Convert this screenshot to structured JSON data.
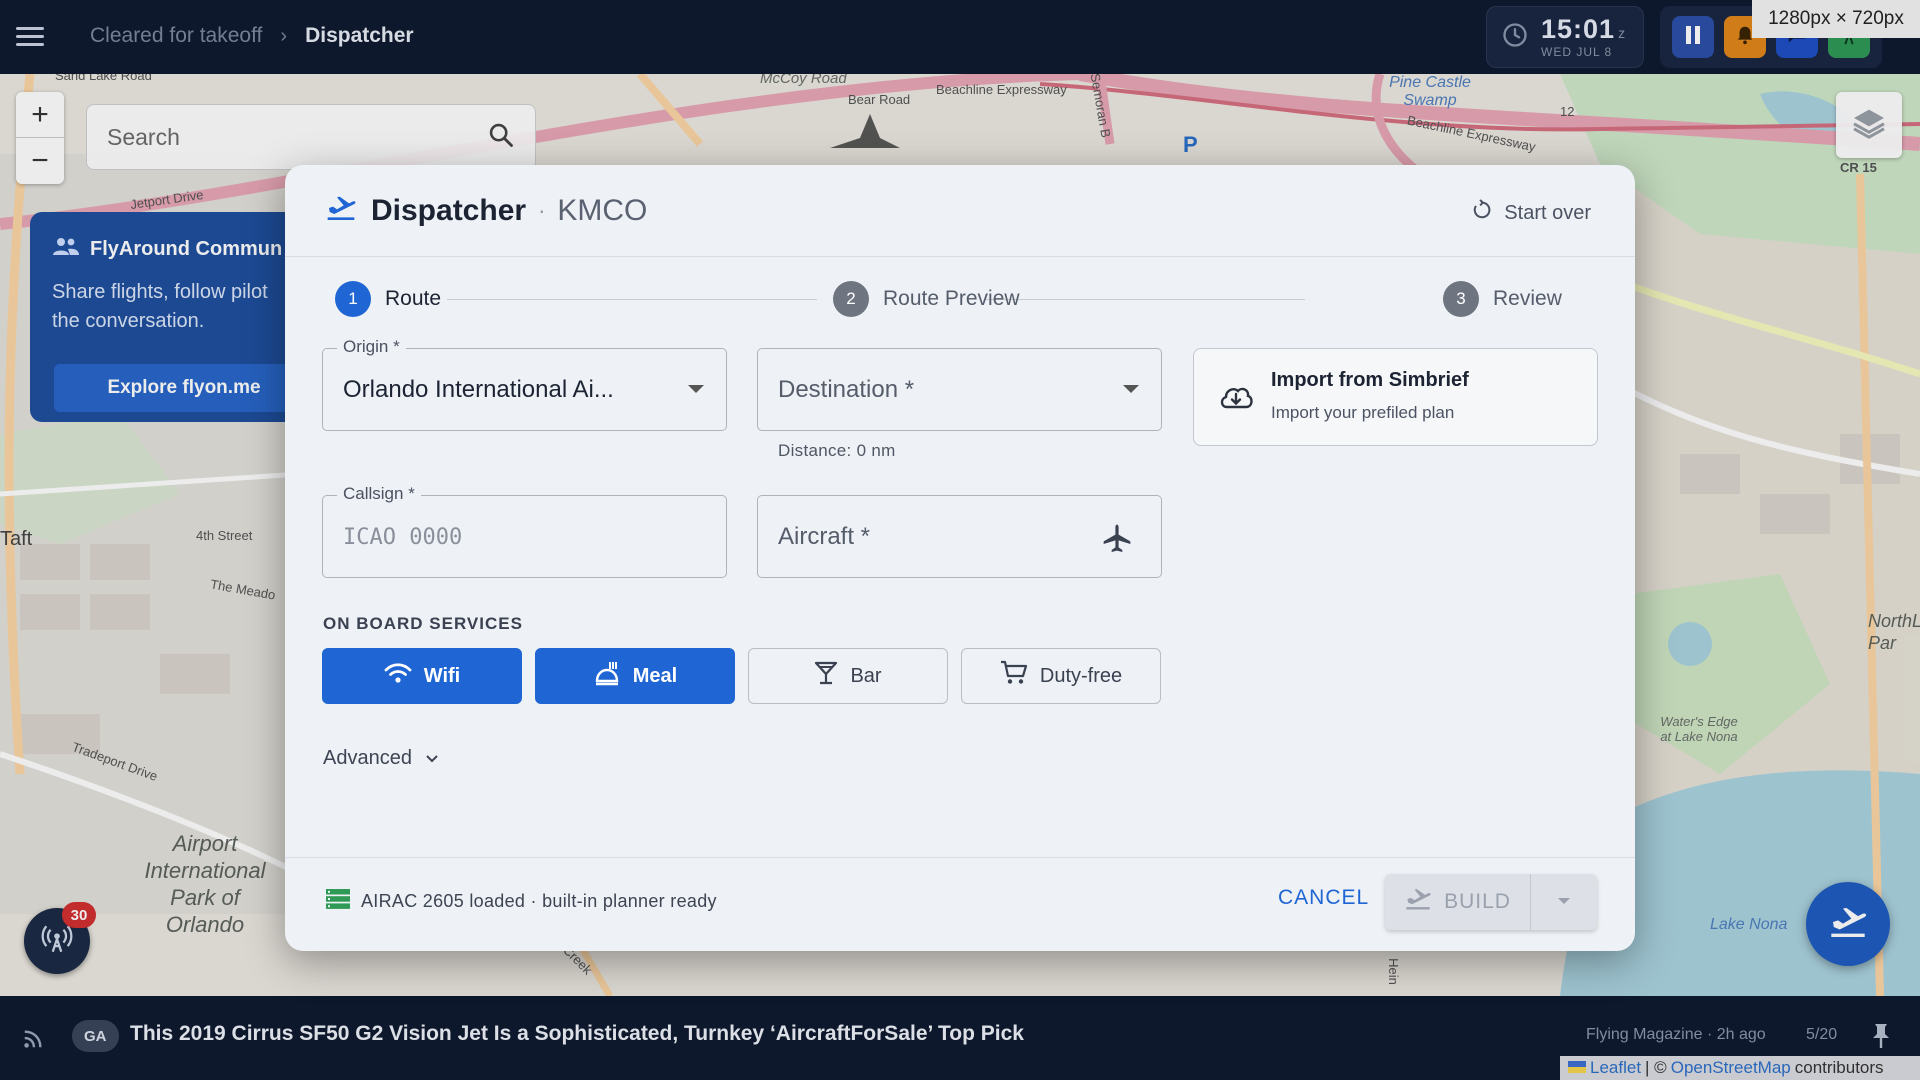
{
  "topbar": {
    "breadcrumb_parent": "Cleared for takeoff",
    "breadcrumb_separator": "›",
    "breadcrumb_current": "Dispatcher",
    "clock_time": "15:01",
    "clock_zone": "z",
    "clock_date": "WED JUL 8",
    "viewport_badge": "1280px × 720px",
    "button_colors": [
      "#2b4fa8",
      "#e0861a",
      "#1f4fc4",
      "#2e9a55"
    ]
  },
  "map": {
    "search_placeholder": "Search",
    "zoom_in": "+",
    "zoom_out": "−",
    "labels": {
      "mccoy_road": "McCoy Road",
      "bear_road": "Bear Road",
      "beachline_1": "Beachline Expressway",
      "beachline_2": "Beachline Expressway",
      "semoran": "Semoran B",
      "parking": "P",
      "pine_castle": "Pine Castle Swamp",
      "sand_lake": "Sand Lake Road",
      "jetport": "Jetport Drive",
      "taft": "Taft",
      "fourth_street": "4th Street",
      "the_meadow": "The Meado",
      "tradeport": "Tradeport Drive",
      "airport_park": "Airport International Park of Orlando",
      "cr15": "CR 15",
      "route_12": "12",
      "waters_edge": "Water's Edge at Lake Nona",
      "lake_nona": "Lake Nona",
      "northlake": "NorthL Par",
      "heintzelman": "Hein",
      "joy_creek": "Joy Creek"
    },
    "radio_badge_count": "30"
  },
  "community": {
    "title": "FlyAround Commun",
    "text": "Share flights, follow pilot the conversation.",
    "button": "Explore flyon.me"
  },
  "dialog": {
    "title": "Dispatcher",
    "separator": "·",
    "airport": "KMCO",
    "start_over": "Start over",
    "steps": [
      {
        "num": "1",
        "label": "Route"
      },
      {
        "num": "2",
        "label": "Route Preview"
      },
      {
        "num": "3",
        "label": "Review"
      }
    ],
    "origin_label": "Origin *",
    "origin_value": "Orlando International Ai...",
    "destination_placeholder": "Destination *",
    "distance": "Distance: 0 nm",
    "import_title": "Import from Simbrief",
    "import_sub": "Import your prefiled plan",
    "callsign_label": "Callsign *",
    "callsign_placeholder": "ICAO 0000",
    "aircraft_placeholder": "Aircraft *",
    "services_label": "ON BOARD SERVICES",
    "services": [
      {
        "label": "Wifi",
        "selected": true
      },
      {
        "label": "Meal",
        "selected": true
      },
      {
        "label": "Bar",
        "selected": false
      },
      {
        "label": "Duty-free",
        "selected": false
      }
    ],
    "advanced": "Advanced",
    "airac_status": "AIRAC 2605 loaded · built-in planner ready",
    "cancel": "CANCEL",
    "build": "BUILD",
    "accent_color": "#1f66d4"
  },
  "news": {
    "tag": "GA",
    "headline": "This 2019 Cirrus SF50 G2 Vision Jet Is a Sophisticated, Turnkey ‘AircraftForSale’ Top Pick",
    "source": "Flying Magazine · 2h ago",
    "count": "5/20"
  },
  "attribution": {
    "leaflet": "Leaflet",
    "separator": "| ©",
    "osm": "OpenStreetMap",
    "contributors": "contributors"
  }
}
